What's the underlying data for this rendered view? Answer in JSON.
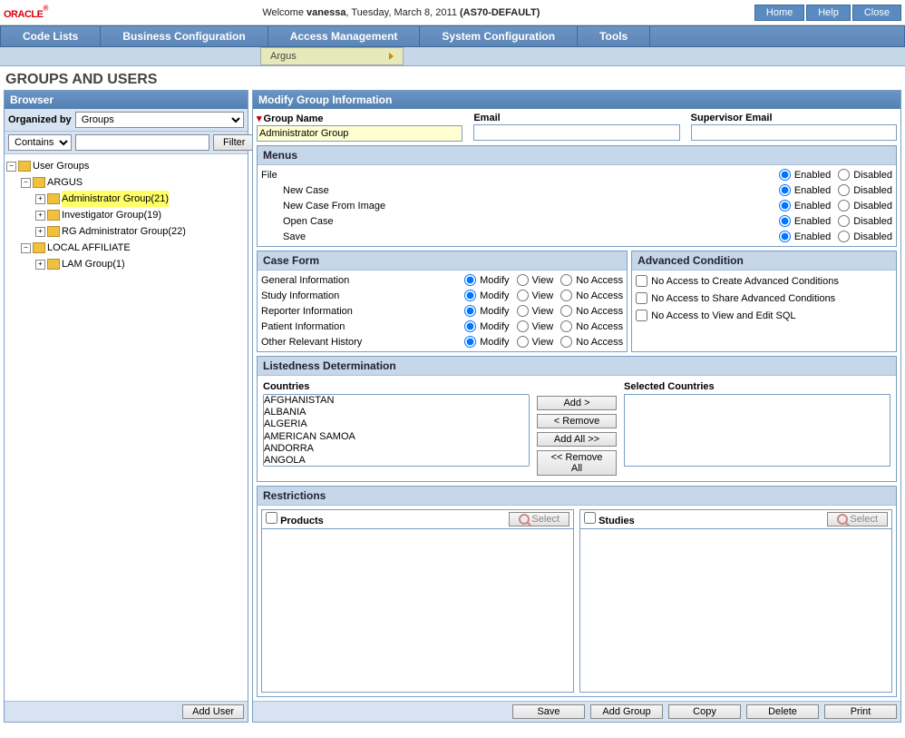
{
  "brand": "ORACLE",
  "welcome_prefix": "Welcome ",
  "user": "vanessa",
  "welcome_date": ", Tuesday, March 8, 2011 ",
  "scope": "(AS70-DEFAULT)",
  "topbtns": {
    "home": "Home",
    "help": "Help",
    "close": "Close"
  },
  "menubar": {
    "code": "Code Lists",
    "biz": "Business Configuration",
    "access": "Access Management",
    "sys": "System Configuration",
    "tools": "Tools"
  },
  "submenu_item": "Argus",
  "page_title": "GROUPS AND USERS",
  "browser_hdr": "Browser",
  "organized_by": "Organized by",
  "organized_value": "Groups",
  "filter_mode": "Contains",
  "filter_btn": "Filter",
  "tree": {
    "root": "User Groups",
    "argus": "ARGUS",
    "admin": "Administrator Group(21)",
    "inv": "Investigator Group(19)",
    "rg": "RG Administrator Group(22)",
    "local": "LOCAL AFFILIATE",
    "lam": "LAM Group(1)"
  },
  "add_user": "Add User",
  "modify_hdr": "Modify Group Information",
  "labels": {
    "group_name": "Group Name",
    "email": "Email",
    "sup_email": "Supervisor Email"
  },
  "group_name_value": "Administrator Group",
  "menus_hdr": "Menus",
  "enabled": "Enabled",
  "disabled": "Disabled",
  "menu_items": {
    "file": "File",
    "newcase": "New Case",
    "newimg": "New Case From Image",
    "open": "Open Case",
    "save": "Save"
  },
  "caseform_hdr": "Case Form",
  "modify": "Modify",
  "view": "View",
  "noaccess": "No Access",
  "case_items": {
    "gen": "General Information",
    "study": "Study Information",
    "rep": "Reporter Information",
    "pat": "Patient Information",
    "other": "Other Relevant History"
  },
  "adv_hdr": "Advanced Condition",
  "adv_items": {
    "create": "No Access to Create Advanced Conditions",
    "share": "No Access to Share Advanced Conditions",
    "sql": "No Access to View and Edit SQL"
  },
  "listed_hdr": "Listedness Determination",
  "countries_label": "Countries",
  "selected_label": "Selected Countries",
  "countries": [
    "AFGHANISTAN",
    "ALBANIA",
    "ALGERIA",
    "AMERICAN SAMOA",
    "ANDORRA",
    "ANGOLA"
  ],
  "btns": {
    "add": "Add >",
    "remove": "< Remove",
    "addall": "Add All >>",
    "removeall": "<< Remove All"
  },
  "restrictions_hdr": "Restrictions",
  "products": "Products",
  "studies": "Studies",
  "select": "Select",
  "footer_btns": {
    "save": "Save",
    "addgroup": "Add Group",
    "copy": "Copy",
    "delete": "Delete",
    "print": "Print"
  }
}
